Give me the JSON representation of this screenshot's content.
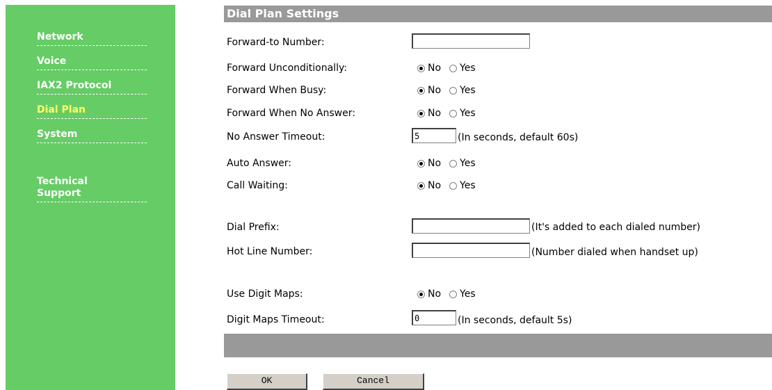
{
  "sidebar": {
    "items": [
      {
        "label": "Network"
      },
      {
        "label": "Voice"
      },
      {
        "label": "IAX2 Protocol"
      },
      {
        "label": "Dial Plan",
        "active": true
      },
      {
        "label": "System"
      },
      {
        "label": "Technical\nSupport"
      }
    ]
  },
  "main": {
    "title": "Dial Plan Settings",
    "forward_to": {
      "label": "Forward-to Number:",
      "value": ""
    },
    "forward_uncond": {
      "label": "Forward Unconditionally:",
      "no": "No",
      "yes": "Yes",
      "selected": "No"
    },
    "forward_busy": {
      "label": "Forward When Busy:",
      "no": "No",
      "yes": "Yes",
      "selected": "No"
    },
    "forward_noanswer": {
      "label": "Forward When No Answer:",
      "no": "No",
      "yes": "Yes",
      "selected": "No"
    },
    "no_answer_timeout": {
      "label": "No Answer Timeout:",
      "value": "5",
      "note": "(In seconds, default 60s)"
    },
    "auto_answer": {
      "label": "Auto Answer:",
      "no": "No",
      "yes": "Yes",
      "selected": "No"
    },
    "call_waiting": {
      "label": "Call Waiting:",
      "no": "No",
      "yes": "Yes",
      "selected": "No"
    },
    "dial_prefix": {
      "label": "Dial Prefix:",
      "value": "",
      "note": "(It's added to each dialed number)"
    },
    "hot_line": {
      "label": "Hot Line Number:",
      "value": "",
      "note": "(Number dialed when handset up)"
    },
    "use_digit_maps": {
      "label": "Use Digit Maps:",
      "no": "No",
      "yes": "Yes",
      "selected": "No"
    },
    "digit_maps_timeout": {
      "label": "Digit Maps Timeout:",
      "value": "0",
      "note": "(In seconds, default 5s)"
    },
    "ok_label": "OK",
    "cancel_label": "Cancel"
  },
  "colors": {
    "sidebar_bg": "#66cc66",
    "active_nav": "#ffff66",
    "bar_bg": "#999999"
  }
}
